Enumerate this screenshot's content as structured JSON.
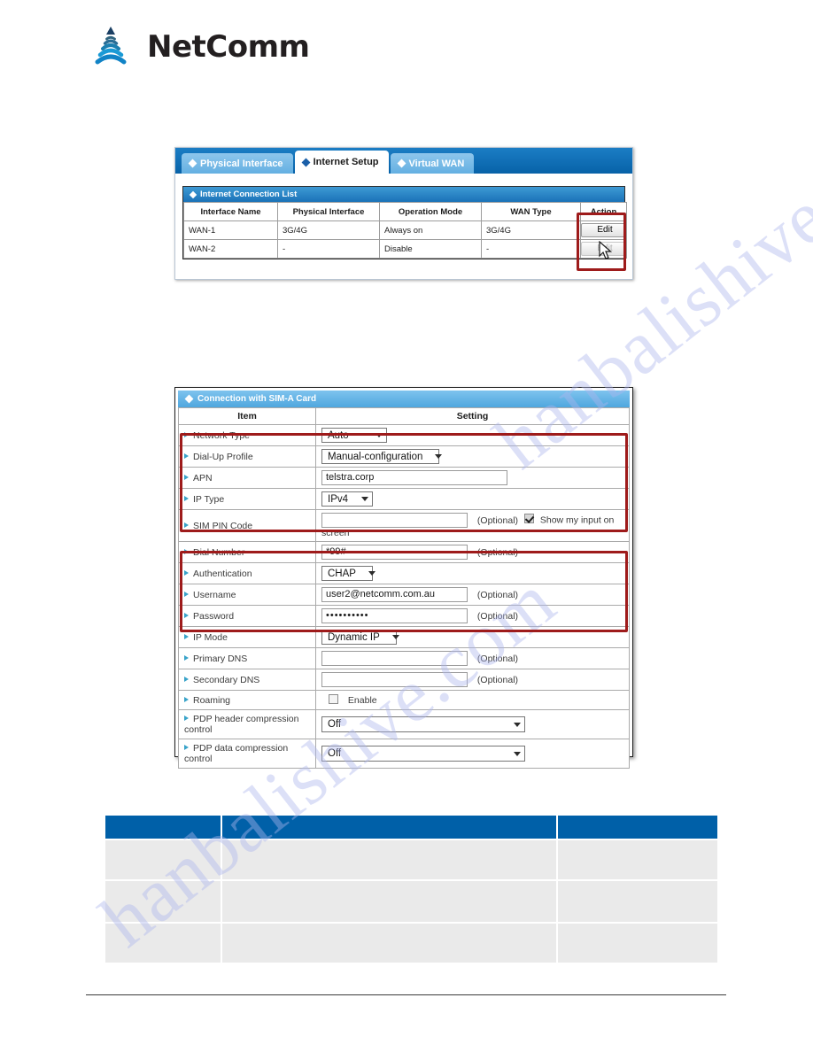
{
  "brand": {
    "name": "NetComm",
    "logo_icon": "netcomm-wave-logo"
  },
  "top_screenshot": {
    "tabs": [
      {
        "label": "Physical Interface",
        "active": false
      },
      {
        "label": "Internet Setup",
        "active": true
      },
      {
        "label": "Virtual WAN",
        "active": false
      }
    ],
    "panel_title": "Internet Connection List",
    "columns": [
      "Interface Name",
      "Physical Interface",
      "Operation Mode",
      "WAN Type",
      "Action"
    ],
    "rows": [
      {
        "interface_name": "WAN-1",
        "physical_interface": "3G/4G",
        "operation_mode": "Always on",
        "wan_type": "3G/4G",
        "action": "Edit",
        "action_disabled": false
      },
      {
        "interface_name": "WAN-2",
        "physical_interface": "-",
        "operation_mode": "Disable",
        "wan_type": "-",
        "action": "Edit",
        "action_disabled": true
      }
    ],
    "annotation": {
      "target": "Action column",
      "color": "#9e1b1b"
    },
    "cursor_on": "Edit"
  },
  "form_screenshot": {
    "panel_title": "Connection with SIM-A Card",
    "col_item": "Item",
    "col_setting": "Setting",
    "rows": {
      "network_type": {
        "label": "Network Type",
        "value": "Auto"
      },
      "dialup_profile": {
        "label": "Dial-Up Profile",
        "value": "Manual-configuration"
      },
      "apn": {
        "label": "APN",
        "value": "telstra.corp"
      },
      "ip_type": {
        "label": "IP Type",
        "value": "IPv4"
      },
      "sim_pin": {
        "label": "SIM PIN Code",
        "value": "",
        "optional": "(Optional)",
        "checkbox_label": "Show my input on screen",
        "checked": true
      },
      "dial_number": {
        "label": "Dial Number",
        "value": "*99#",
        "optional": "(Optional)"
      },
      "authentication": {
        "label": "Authentication",
        "value": "CHAP"
      },
      "username": {
        "label": "Username",
        "value": "user2@netcomm.com.au",
        "optional": "(Optional)"
      },
      "password": {
        "label": "Password",
        "value": "••••••••••",
        "optional": "(Optional)"
      },
      "ip_mode": {
        "label": "IP Mode",
        "value": "Dynamic IP"
      },
      "primary_dns": {
        "label": "Primary DNS",
        "value": "",
        "optional": "(Optional)"
      },
      "secondary_dns": {
        "label": "Secondary DNS",
        "value": "",
        "optional": "(Optional)"
      },
      "roaming": {
        "label": "Roaming",
        "checkbox_label": "Enable",
        "checked": false
      },
      "pdp_header": {
        "label": "PDP header compression control",
        "value": "Off"
      },
      "pdp_data": {
        "label": "PDP data compression control",
        "value": "Off"
      }
    },
    "annotations": [
      {
        "spans": "Network Type - SIM PIN Code",
        "color": "#9e1b1b"
      },
      {
        "spans": "Authentication - IP Mode",
        "color": "#9e1b1b"
      }
    ]
  },
  "bottom_table": {
    "header_color": "#0060a8",
    "row_color": "#eaeaea",
    "columns": [
      "",
      "",
      ""
    ],
    "rows": [
      [
        "",
        "",
        ""
      ],
      [
        "",
        "",
        ""
      ],
      [
        "",
        "",
        ""
      ]
    ]
  },
  "watermark": {
    "line1": "hanbalishive.com",
    "line2": "hanbalishive.com"
  }
}
